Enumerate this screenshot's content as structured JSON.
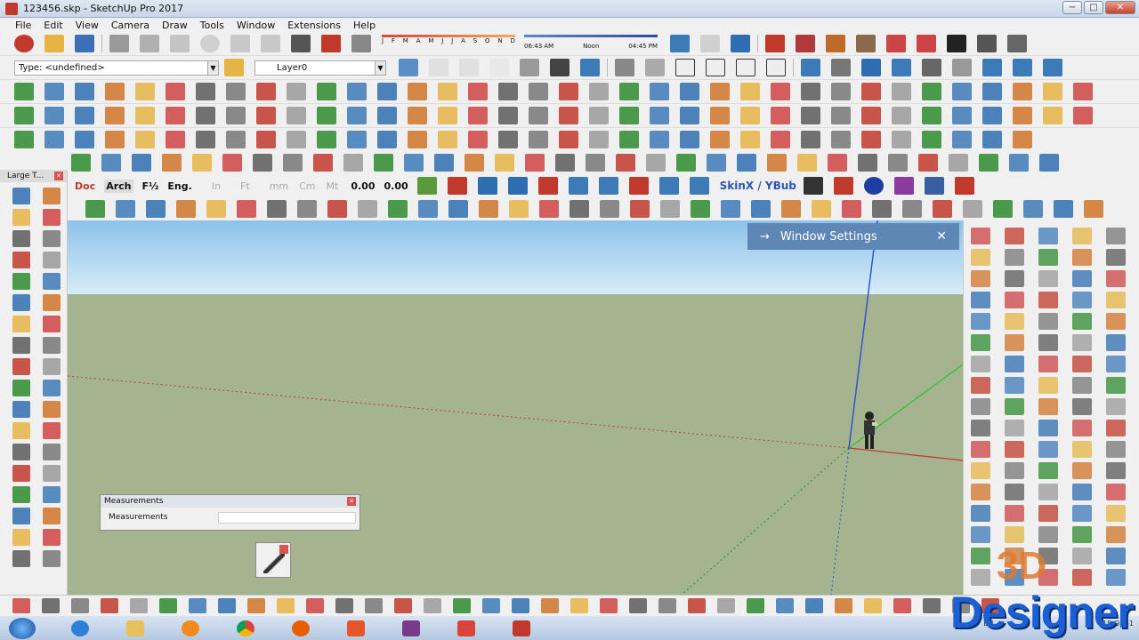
{
  "window": {
    "title": "123456.skp - SketchUp Pro 2017",
    "btn_min": "−",
    "btn_max": "□",
    "btn_close": "✕"
  },
  "menu": [
    "File",
    "Edit",
    "View",
    "Camera",
    "Draw",
    "Tools",
    "Window",
    "Extensions",
    "Help"
  ],
  "entity_info": {
    "type_label": "Type: <undefined>",
    "layer_label": "Layer0"
  },
  "shadow": {
    "months": [
      "J",
      "F",
      "M",
      "A",
      "M",
      "J",
      "J",
      "A",
      "S",
      "O",
      "N",
      "D"
    ],
    "time_start": "06:43 AM",
    "time_noon": "Noon",
    "time_end": "04:45 PM"
  },
  "units_toolbar": [
    "Doc",
    "Arch",
    "F½",
    "Eng.",
    "In",
    "Ft",
    "mm",
    "Cm",
    "Mt",
    "0.00",
    "0.00"
  ],
  "skinx_label": "SkinX / YBub",
  "left_palette_title": "Large T...",
  "tray": {
    "title": "Window Settings",
    "arrow": "→",
    "close": "✕"
  },
  "measurements": {
    "title": "Measurements",
    "label": "Measurements",
    "value": ""
  },
  "taskbar": {
    "lang": "EN",
    "date": "15-Oct-1"
  },
  "watermark": {
    "three": "3D",
    "brand": "Designer"
  },
  "colors": {
    "sky_top": "#8cc2ea",
    "ground": "#a3b48f",
    "tray_header": "#5f87b5",
    "axis_red": "#c0392b",
    "axis_green": "#2ec02e",
    "axis_blue": "#2b4fd0"
  }
}
